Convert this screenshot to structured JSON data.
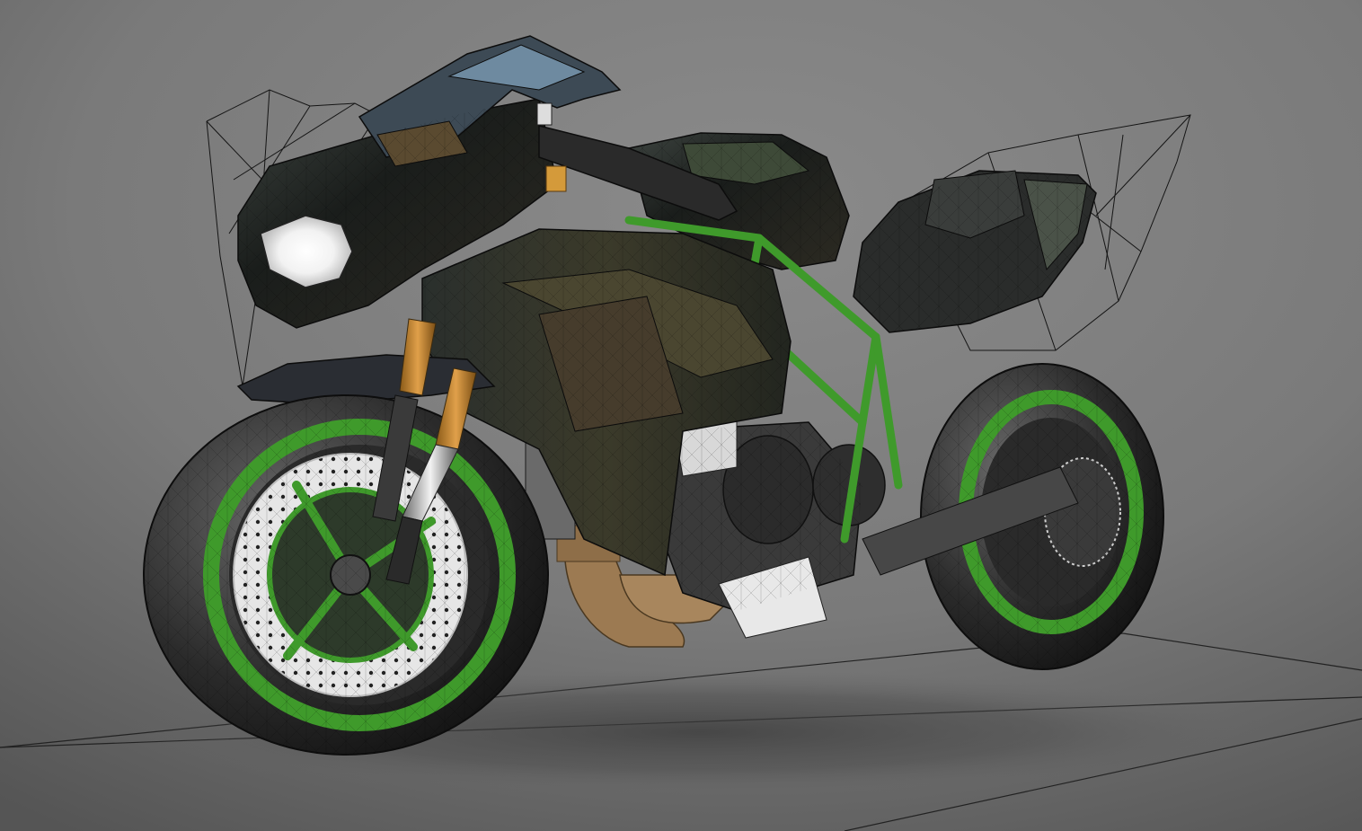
{
  "viewport": {
    "render_mode": "shaded-with-wireframe",
    "background_color_top": "#5e5e5e",
    "background_color_bottom": "#9a9a9a",
    "wireframe_color": "#1a1a1a"
  },
  "model": {
    "body_color": "#1c1f1d",
    "accent_color": "#3f9a2b",
    "fork_color": "#c8862c",
    "disc_color": "#e8e8e8",
    "exhaust_color": "#9c7a52",
    "headlight_color": "#ffffff"
  }
}
